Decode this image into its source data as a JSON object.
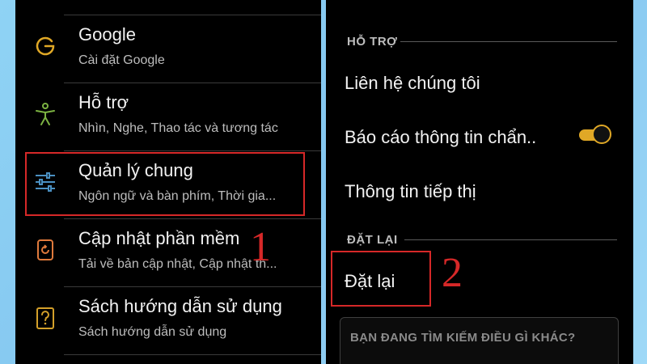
{
  "left_menu": {
    "items": [
      {
        "title": "Google",
        "subtitle": "Cài đặt Google",
        "icon": "google-g-icon"
      },
      {
        "title": "Hỗ trợ",
        "subtitle": "Nhìn, Nghe, Thao tác và tương tác",
        "icon": "accessibility-person-icon"
      },
      {
        "title": "Quản lý chung",
        "subtitle": "Ngôn ngữ và bàn phím, Thời gia...",
        "icon": "sliders-icon"
      },
      {
        "title": "Cập nhật phần mềm",
        "subtitle": "Tải về bản cập nhật, Cập nhật th...",
        "icon": "software-update-icon"
      },
      {
        "title": "Sách hướng dẫn sử dụng",
        "subtitle": "Sách hướng dẫn sử dụng",
        "icon": "user-manual-icon"
      }
    ]
  },
  "right_menu": {
    "support_header": "HỖ TRỢ",
    "contact_us": "Liên hệ chúng tôi",
    "diagnostic_report": "Báo cáo thông tin chẩn..",
    "diagnostic_report_enabled": true,
    "marketing_info": "Thông tin tiếp thị",
    "reset_header": "ĐẶT LẠI",
    "reset": "Đặt lại",
    "search_prompt": "BẠN ĐANG TÌM KIẾM ĐIỀU GÌ KHÁC?"
  },
  "annotations": {
    "step1": "1",
    "step2": "2"
  },
  "colors": {
    "highlight_red": "#d62828",
    "toggle_on": "#e0a826",
    "google_icon": "#e0a826",
    "accessibility_icon": "#7cb342",
    "sliders_icon": "#4a90c2",
    "update_icon": "#e07a3c",
    "manual_icon": "#d4a02a"
  }
}
